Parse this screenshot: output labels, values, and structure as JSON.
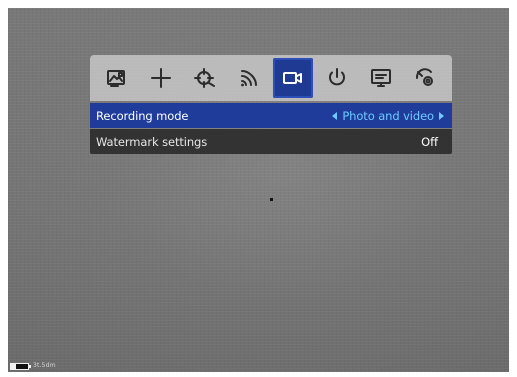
{
  "menu": {
    "tabs": [
      {
        "icon": "image-mode-icon",
        "active": false
      },
      {
        "icon": "crosshair-icon",
        "active": false
      },
      {
        "icon": "zeroing-icon",
        "active": false
      },
      {
        "icon": "wifi-icon",
        "active": false
      },
      {
        "icon": "video-camera-icon",
        "active": true
      },
      {
        "icon": "power-icon",
        "active": false
      },
      {
        "icon": "display-icon",
        "active": false
      },
      {
        "icon": "settings-icon",
        "active": false
      }
    ],
    "rows": [
      {
        "label": "Recording mode",
        "value": "Photo and video",
        "selected": true
      },
      {
        "label": "Watermark settings",
        "value": "Off",
        "selected": false
      }
    ]
  },
  "status": {
    "distance": "3t.5dm"
  },
  "colors": {
    "tab_active_bg": "#1f3a93",
    "selected_row_bg": "#1f3c9a",
    "selected_value": "#6ecbff",
    "row_bg": "#2d2d2d"
  }
}
